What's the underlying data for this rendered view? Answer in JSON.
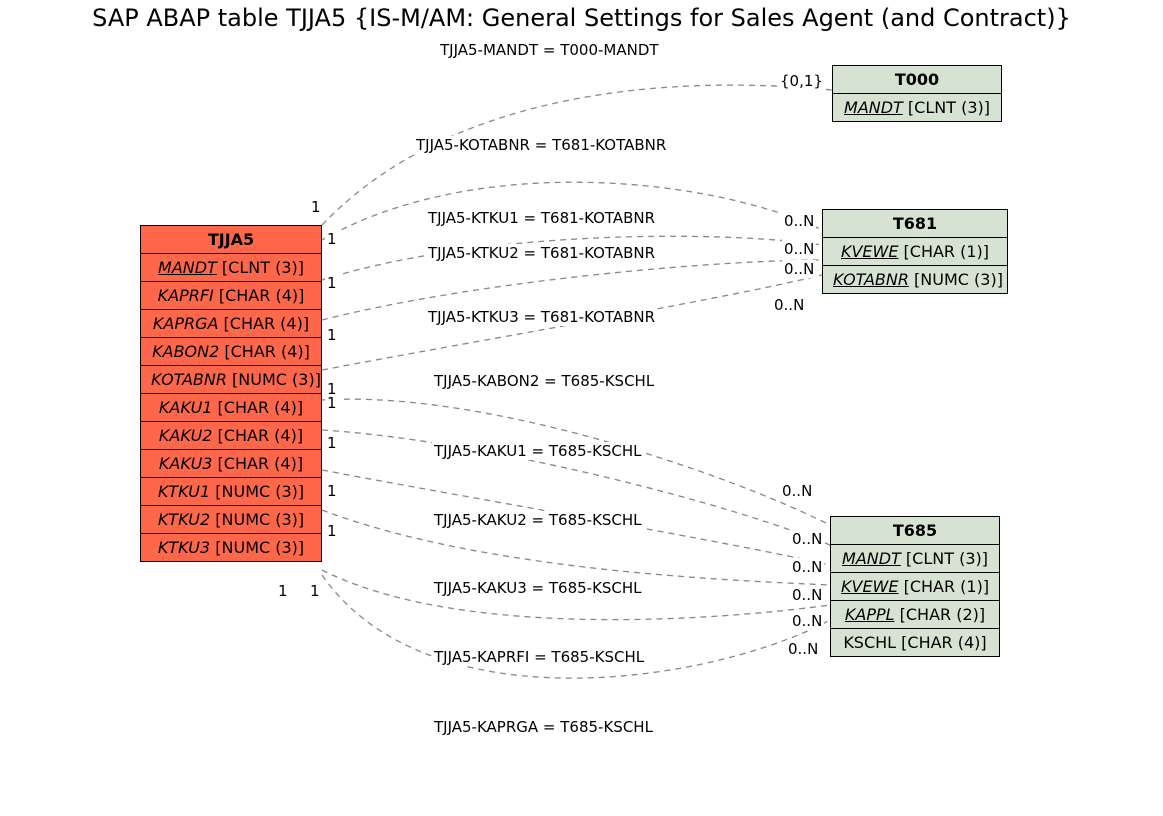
{
  "title": "SAP ABAP table TJJA5 {IS-M/AM: General Settings for Sales Agent (and Contract)}",
  "entities": {
    "tjja5": {
      "name": "TJJA5",
      "fields": [
        "MANDT [CLNT (3)]",
        "KAPRFI [CHAR (4)]",
        "KAPRGA [CHAR (4)]",
        "KABON2 [CHAR (4)]",
        "KOTABNR [NUMC (3)]",
        "KAKU1 [CHAR (4)]",
        "KAKU2 [CHAR (4)]",
        "KAKU3 [CHAR (4)]",
        "KTKU1 [NUMC (3)]",
        "KTKU2 [NUMC (3)]",
        "KTKU3 [NUMC (3)]"
      ]
    },
    "t000": {
      "name": "T000",
      "fields": [
        "MANDT [CLNT (3)]"
      ]
    },
    "t681": {
      "name": "T681",
      "fields": [
        "KVEWE [CHAR (1)]",
        "KOTABNR [NUMC (3)]"
      ]
    },
    "t685": {
      "name": "T685",
      "fields": [
        "MANDT [CLNT (3)]",
        "KVEWE [CHAR (1)]",
        "KAPPL [CHAR (2)]",
        "KSCHL [CHAR (4)]"
      ]
    }
  },
  "relations": {
    "r1": "TJJA5-MANDT = T000-MANDT",
    "r2": "TJJA5-KOTABNR = T681-KOTABNR",
    "r3": "TJJA5-KTKU1 = T681-KOTABNR",
    "r4": "TJJA5-KTKU2 = T681-KOTABNR",
    "r5": "TJJA5-KTKU3 = T681-KOTABNR",
    "r6": "TJJA5-KABON2 = T685-KSCHL",
    "r7": "TJJA5-KAKU1 = T685-KSCHL",
    "r8": "TJJA5-KAKU2 = T685-KSCHL",
    "r9": "TJJA5-KAKU3 = T685-KSCHL",
    "r10": "TJJA5-KAPRFI = T685-KSCHL",
    "r11": "TJJA5-KAPRGA = T685-KSCHL"
  },
  "card": {
    "c1a": "1",
    "c1b": "{0,1}",
    "c2a": "1",
    "c2b": "0..N",
    "c3a": "1",
    "c3b": "0..N",
    "c4a": "1",
    "c4b": "0..N",
    "c5a": "1",
    "c5b": "0..N",
    "c6a": "1",
    "c6b": "0..N",
    "c7a": "1",
    "c7b": "0..N",
    "c8a": "1",
    "c8b": "0..N",
    "c9a": "1",
    "c9b": "0..N",
    "c10a": "1",
    "c10b": "0..N",
    "c11a": "1",
    "c11b": "0..N"
  }
}
